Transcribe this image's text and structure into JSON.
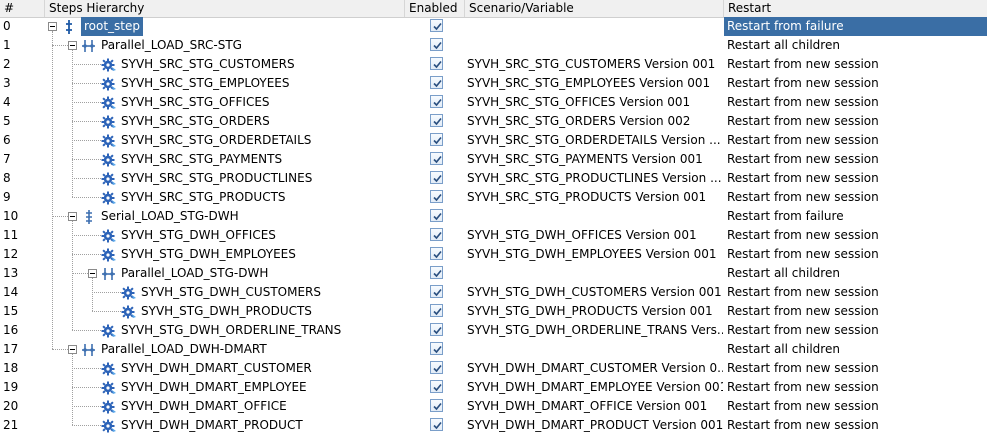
{
  "columns": {
    "num": "#",
    "steps": "Steps Hierarchy",
    "enabled": "Enabled",
    "scenario": "Scenario/Variable",
    "restart": "Restart"
  },
  "rows": [
    {
      "num": "0",
      "level": 0,
      "type": "root",
      "label": "root_step",
      "enabled": true,
      "scenario": "",
      "restart": "Restart from failure",
      "selected": true
    },
    {
      "num": "1",
      "level": 1,
      "type": "parallel",
      "label": "Parallel_LOAD_SRC-STG",
      "enabled": true,
      "scenario": "",
      "restart": "Restart all children"
    },
    {
      "num": "2",
      "level": 2,
      "type": "scenario",
      "label": "SYVH_SRC_STG_CUSTOMERS",
      "enabled": true,
      "scenario": "SYVH_SRC_STG_CUSTOMERS Version 001",
      "restart": "Restart from new session"
    },
    {
      "num": "3",
      "level": 2,
      "type": "scenario",
      "label": "SYVH_SRC_STG_EMPLOYEES",
      "enabled": true,
      "scenario": "SYVH_SRC_STG_EMPLOYEES Version 001",
      "restart": "Restart from new session"
    },
    {
      "num": "4",
      "level": 2,
      "type": "scenario",
      "label": "SYVH_SRC_STG_OFFICES",
      "enabled": true,
      "scenario": "SYVH_SRC_STG_OFFICES Version 001",
      "restart": "Restart from new session"
    },
    {
      "num": "5",
      "level": 2,
      "type": "scenario",
      "label": "SYVH_SRC_STG_ORDERS",
      "enabled": true,
      "scenario": "SYVH_SRC_STG_ORDERS Version 002",
      "restart": "Restart from new session"
    },
    {
      "num": "6",
      "level": 2,
      "type": "scenario",
      "label": "SYVH_SRC_STG_ORDERDETAILS",
      "enabled": true,
      "scenario": "SYVH_SRC_STG_ORDERDETAILS Version ...",
      "restart": "Restart from new session"
    },
    {
      "num": "7",
      "level": 2,
      "type": "scenario",
      "label": "SYVH_SRC_STG_PAYMENTS",
      "enabled": true,
      "scenario": "SYVH_SRC_STG_PAYMENTS Version 001",
      "restart": "Restart from new session"
    },
    {
      "num": "8",
      "level": 2,
      "type": "scenario",
      "label": "SYVH_SRC_STG_PRODUCTLINES",
      "enabled": true,
      "scenario": "SYVH_SRC_STG_PRODUCTLINES Version ...",
      "restart": "Restart from new session"
    },
    {
      "num": "9",
      "level": 2,
      "type": "scenario",
      "label": "SYVH_SRC_STG_PRODUCTS",
      "enabled": true,
      "scenario": "SYVH_SRC_STG_PRODUCTS Version 001",
      "restart": "Restart from new session"
    },
    {
      "num": "10",
      "level": 1,
      "type": "serial",
      "label": "Serial_LOAD_STG-DWH",
      "enabled": true,
      "scenario": "",
      "restart": "Restart from failure"
    },
    {
      "num": "11",
      "level": 2,
      "type": "scenario",
      "label": "SYVH_STG_DWH_OFFICES",
      "enabled": true,
      "scenario": "SYVH_STG_DWH_OFFICES Version 001",
      "restart": "Restart from new session"
    },
    {
      "num": "12",
      "level": 2,
      "type": "scenario",
      "label": "SYVH_STG_DWH_EMPLOYEES",
      "enabled": true,
      "scenario": "SYVH_STG_DWH_EMPLOYEES Version 001",
      "restart": "Restart from new session"
    },
    {
      "num": "13",
      "level": 2,
      "type": "parallel",
      "label": "Parallel_LOAD_STG-DWH",
      "enabled": true,
      "scenario": "",
      "restart": "Restart all children"
    },
    {
      "num": "14",
      "level": 3,
      "type": "scenario",
      "label": "SYVH_STG_DWH_CUSTOMERS",
      "enabled": true,
      "scenario": "SYVH_STG_DWH_CUSTOMERS Version 001",
      "restart": "Restart from new session"
    },
    {
      "num": "15",
      "level": 3,
      "type": "scenario",
      "label": "SYVH_STG_DWH_PRODUCTS",
      "enabled": true,
      "scenario": "SYVH_STG_DWH_PRODUCTS Version 001",
      "restart": "Restart from new session"
    },
    {
      "num": "16",
      "level": 2,
      "type": "scenario",
      "label": "SYVH_STG_DWH_ORDERLINE_TRANS",
      "enabled": true,
      "scenario": "SYVH_STG_DWH_ORDERLINE_TRANS Vers...",
      "restart": "Restart from new session"
    },
    {
      "num": "17",
      "level": 1,
      "type": "parallel",
      "label": "Parallel_LOAD_DWH-DMART",
      "enabled": true,
      "scenario": "",
      "restart": "Restart all children"
    },
    {
      "num": "18",
      "level": 2,
      "type": "scenario",
      "label": "SYVH_DWH_DMART_CUSTOMER",
      "enabled": true,
      "scenario": "SYVH_DWH_DMART_CUSTOMER Version 0...",
      "restart": "Restart from new session"
    },
    {
      "num": "19",
      "level": 2,
      "type": "scenario",
      "label": "SYVH_DWH_DMART_EMPLOYEE",
      "enabled": true,
      "scenario": "SYVH_DWH_DMART_EMPLOYEE Version 001",
      "restart": "Restart from new session"
    },
    {
      "num": "20",
      "level": 2,
      "type": "scenario",
      "label": "SYVH_DWH_DMART_OFFICE",
      "enabled": true,
      "scenario": "SYVH_DWH_DMART_OFFICE Version 001",
      "restart": "Restart from new session"
    },
    {
      "num": "21",
      "level": 2,
      "type": "scenario",
      "label": "SYVH_DWH_DMART_PRODUCT",
      "enabled": true,
      "scenario": "SYVH_DWH_DMART_PRODUCT Version 001",
      "restart": "Restart from new session"
    }
  ],
  "colors": {
    "selection": "#3a6ea5",
    "header_bg": "#f0f0f0",
    "gear_icon": "#2c63b8",
    "parallel_icon": "#3d6fb0"
  }
}
